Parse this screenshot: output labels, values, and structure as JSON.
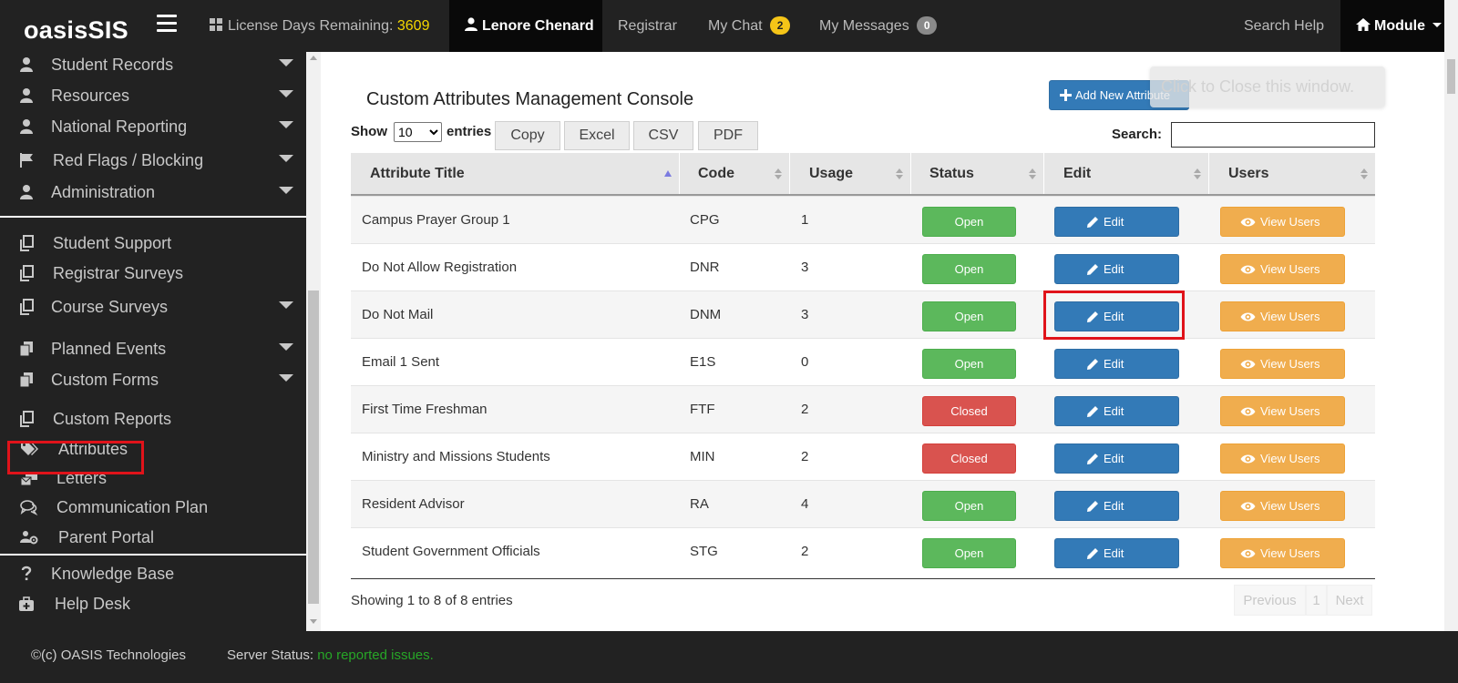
{
  "app": {
    "brand": "oasisSIS"
  },
  "topnav": {
    "license_label": "License Days Remaining:",
    "license_days": "3609",
    "user_name": "Lenore Chenard",
    "registrar": "Registrar",
    "chat": "My Chat",
    "chat_count": "2",
    "messages": "My Messages",
    "messages_count": "0",
    "search_help": "Search Help",
    "module": "Module"
  },
  "sidebar": {
    "items": [
      {
        "label": "Student Records",
        "icon": "user-icon",
        "has_submenu": true
      },
      {
        "label": "Resources",
        "icon": "user-icon",
        "has_submenu": true
      },
      {
        "label": "National Reporting",
        "icon": "user-icon",
        "has_submenu": true
      },
      {
        "label": "Red Flags / Blocking",
        "icon": "flag-icon",
        "has_submenu": true
      },
      {
        "label": "Administration",
        "icon": "user-icon",
        "has_submenu": true
      },
      {
        "label": "Student Support",
        "icon": "copy-icon",
        "has_submenu": false
      },
      {
        "label": "Registrar Surveys",
        "icon": "copy-icon",
        "has_submenu": false
      },
      {
        "label": "Course Surveys",
        "icon": "copy-icon",
        "has_submenu": true
      },
      {
        "label": "Planned Events",
        "icon": "files-icon",
        "has_submenu": true
      },
      {
        "label": "Custom Forms",
        "icon": "files-icon",
        "has_submenu": true
      },
      {
        "label": "Custom Reports",
        "icon": "copy-icon",
        "has_submenu": false
      },
      {
        "label": "Attributes",
        "icon": "tags-icon",
        "has_submenu": false,
        "highlighted": true
      },
      {
        "label": "Letters",
        "icon": "mail-bulk-icon",
        "has_submenu": false
      },
      {
        "label": "Communication Plan",
        "icon": "comments-icon",
        "has_submenu": false
      },
      {
        "label": "Parent Portal",
        "icon": "users-cog-icon",
        "has_submenu": false
      },
      {
        "label": "Knowledge Base",
        "icon": "question-icon",
        "has_submenu": false
      },
      {
        "label": "Help Desk",
        "icon": "medkit-icon",
        "has_submenu": false
      }
    ]
  },
  "main": {
    "title": "Custom Attributes Management Console",
    "add_button": "Add New Attribute",
    "toast": "Click to Close this window.",
    "show_label": "Show",
    "show_value": "10",
    "show_options": [
      "10"
    ],
    "entries_label": "entries",
    "export_buttons": [
      "Copy",
      "Excel",
      "CSV",
      "PDF"
    ],
    "search_label": "Search:",
    "search_value": ""
  },
  "table": {
    "columns": [
      "Attribute Title",
      "Code",
      "Usage",
      "Status",
      "Edit",
      "Users"
    ],
    "sorted_column": "Attribute Title",
    "edit_label": "Edit",
    "view_users_label": "View Users",
    "rows": [
      {
        "title": "Campus Prayer Group 1",
        "code": "CPG",
        "usage": "1",
        "status": "Open"
      },
      {
        "title": "Do Not Allow Registration",
        "code": "DNR",
        "usage": "3",
        "status": "Open"
      },
      {
        "title": "Do Not Mail",
        "code": "DNM",
        "usage": "3",
        "status": "Open",
        "edit_highlighted": true
      },
      {
        "title": "Email 1 Sent",
        "code": "E1S",
        "usage": "0",
        "status": "Open"
      },
      {
        "title": "First Time Freshman",
        "code": "FTF",
        "usage": "2",
        "status": "Closed"
      },
      {
        "title": "Ministry and Missions Students",
        "code": "MIN",
        "usage": "2",
        "status": "Closed"
      },
      {
        "title": "Resident Advisor",
        "code": "RA",
        "usage": "4",
        "status": "Open"
      },
      {
        "title": "Student Government Officials",
        "code": "STG",
        "usage": "2",
        "status": "Open"
      }
    ],
    "info": "Showing 1 to 8 of 8 entries",
    "pagination": {
      "previous": "Previous",
      "page": "1",
      "next": "Next"
    }
  },
  "footer": {
    "copyright": "©(c) OASIS Technologies",
    "server_status_label": "Server Status:",
    "server_status_value": "no reported issues."
  },
  "colors": {
    "navbar": "#222222",
    "primary": "#337ab7",
    "success": "#5cb85c",
    "danger": "#d9534f",
    "warning": "#f0ad4e",
    "highlight_box": "#e0131a",
    "server_ok": "#27a727"
  }
}
